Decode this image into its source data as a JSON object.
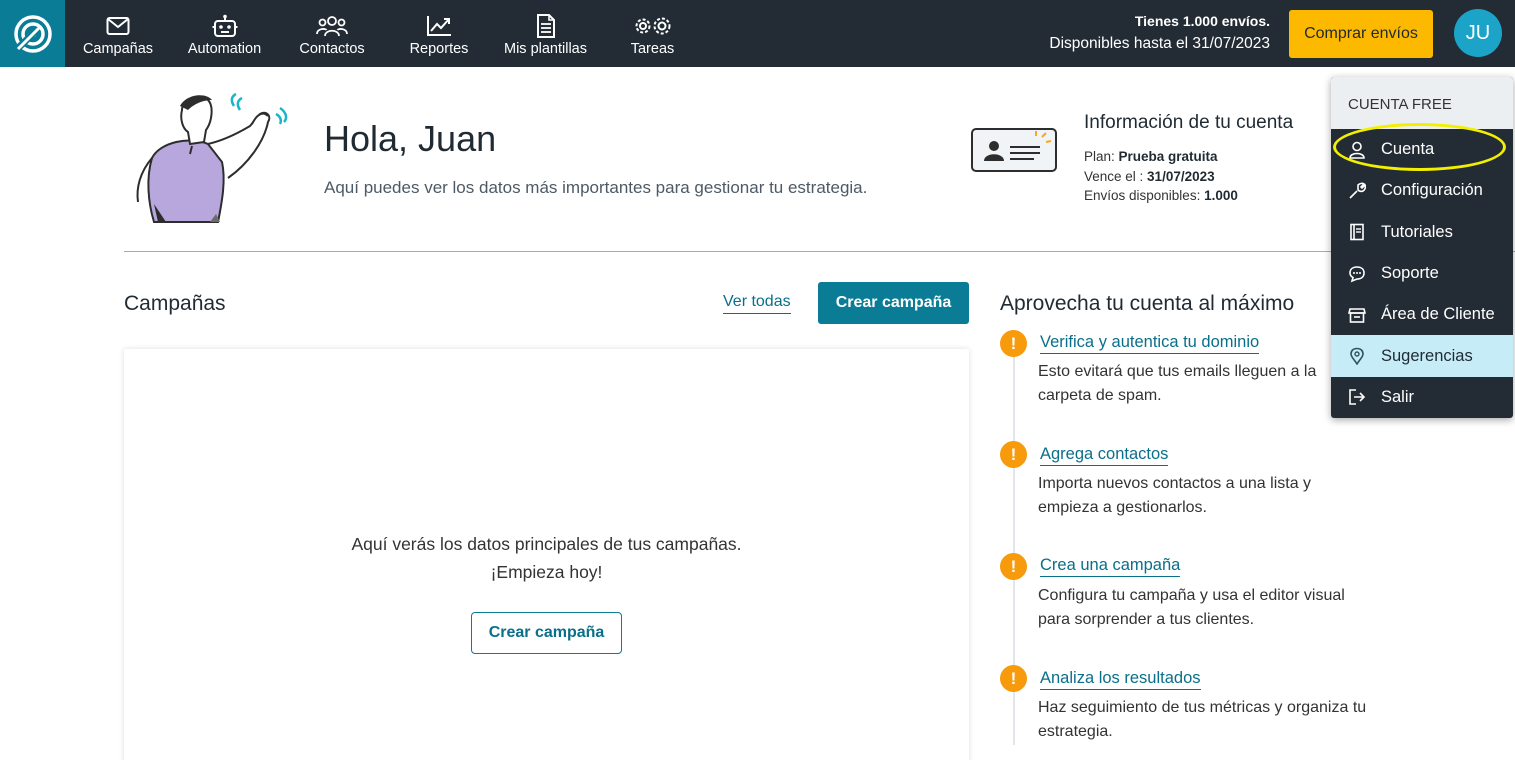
{
  "nav": {
    "items": [
      {
        "label": "Campañas",
        "icon": "envelope-icon"
      },
      {
        "label": "Automation",
        "icon": "robot-icon"
      },
      {
        "label": "Contactos",
        "icon": "users-icon"
      },
      {
        "label": "Reportes",
        "icon": "chart-icon"
      },
      {
        "label": "Mis plantillas",
        "icon": "template-icon"
      },
      {
        "label": "Tareas",
        "icon": "gears-icon"
      }
    ]
  },
  "credits": {
    "line1": "Tienes 1.000 envíos.",
    "line2": "Disponibles hasta el 31/07/2023"
  },
  "buy_label": "Comprar envíos",
  "avatar_initials": "JU",
  "hero": {
    "title": "Hola, Juan",
    "subtitle": "Aquí puedes ver los datos más importantes para gestionar tu estrategia."
  },
  "account": {
    "title": "Información de tu cuenta",
    "plan_label": "Plan: ",
    "plan_value": "Prueba gratuita",
    "expires_label": "Vence el : ",
    "expires_value": "31/07/2023",
    "sends_label": "Envíos disponibles: ",
    "sends_value": "1.000"
  },
  "campaigns": {
    "title": "Campañas",
    "see_all": "Ver todas",
    "create_label": "Crear campaña",
    "empty_line1": "Aquí verás los datos principales de tus campañas.",
    "empty_line2": "¡Empieza hoy!",
    "empty_cta": "Crear campaña"
  },
  "tips": {
    "title": "Aprovecha tu cuenta al máximo",
    "items": [
      {
        "link": "Verifica y autentica tu dominio",
        "desc": "Esto evitará que tus emails lleguen a la carpeta de spam."
      },
      {
        "link": "Agrega contactos",
        "desc": "Importa nuevos contactos a una lista y empieza a gestionarlos."
      },
      {
        "link": "Crea una campaña",
        "desc": "Configura tu campaña y usa el editor visual para sorprender a tus clientes."
      },
      {
        "link": "Analiza los resultados",
        "desc": "Haz seguimiento de tus métricas y organiza tu estrategia."
      }
    ]
  },
  "menu": {
    "header": "CUENTA FREE",
    "items": [
      {
        "label": "Cuenta",
        "icon": "user-icon"
      },
      {
        "label": "Configuración",
        "icon": "wrench-icon"
      },
      {
        "label": "Tutoriales",
        "icon": "book-icon"
      },
      {
        "label": "Soporte",
        "icon": "chat-icon"
      },
      {
        "label": "Área de Cliente",
        "icon": "store-icon"
      },
      {
        "label": "Sugerencias",
        "icon": "lightbulb-icon"
      },
      {
        "label": "Salir",
        "icon": "logout-icon"
      }
    ],
    "active_item": "Sugerencias"
  },
  "colors": {
    "topbar": "#232c35",
    "primary": "#0a7c96",
    "buy_button": "#fcb900",
    "tip_badge": "#f79a0b",
    "highlight_ring": "#f3ef00"
  }
}
